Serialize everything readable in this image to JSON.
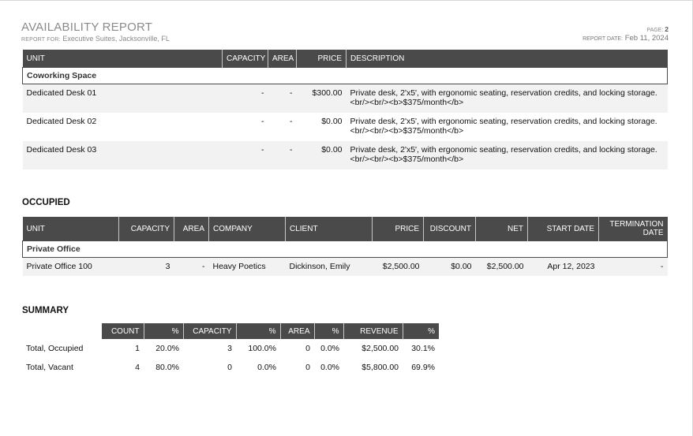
{
  "header": {
    "title": "AVAILABILITY REPORT",
    "report_for_label": "REPORT FOR:",
    "report_for_value": "Executive Suites, Jacksonville, FL",
    "page_label": "PAGE:",
    "page_value": "2",
    "report_date_label": "REPORT DATE:",
    "report_date_value": "Feb 11, 2024"
  },
  "vacant": {
    "columns": [
      "UNIT",
      "CAPACITY",
      "AREA",
      "PRICE",
      "DESCRIPTION"
    ],
    "group": "Coworking Space",
    "rows": [
      {
        "unit": "Dedicated Desk 01",
        "capacity": "-",
        "area": "-",
        "price": "$300.00",
        "description": "Private desk, 2'x5', with ergonomic seating, reservation credits, and locking storage.<br/><br/><b>$375/month</b>"
      },
      {
        "unit": "Dedicated Desk 02",
        "capacity": "-",
        "area": "-",
        "price": "$0.00",
        "description": "Private desk, 2'x5', with ergonomic seating, reservation credits, and locking storage.<br/><br/><b>$375/month</b>"
      },
      {
        "unit": "Dedicated Desk 03",
        "capacity": "-",
        "area": "-",
        "price": "$0.00",
        "description": "Private desk, 2'x5', with ergonomic seating, reservation credits, and locking storage.<br/><br/><b>$375/month</b>"
      }
    ]
  },
  "occupied": {
    "title": "OCCUPIED",
    "columns": [
      "UNIT",
      "CAPACITY",
      "AREA",
      "COMPANY",
      "CLIENT",
      "PRICE",
      "DISCOUNT",
      "NET",
      "START DATE",
      "TERMINATION DATE"
    ],
    "group": "Private Office",
    "rows": [
      {
        "unit": "Private Office 100",
        "capacity": "3",
        "area": "-",
        "company": "Heavy Poetics",
        "client": "Dickinson, Emily",
        "price": "$2,500.00",
        "discount": "$0.00",
        "net": "$2,500.00",
        "start_date": "Apr 12, 2023",
        "termination_date": "-"
      }
    ]
  },
  "summary": {
    "title": "SUMMARY",
    "columns": [
      "",
      "COUNT",
      "%",
      "CAPACITY",
      "%",
      "AREA",
      "%",
      "REVENUE",
      "%"
    ],
    "rows": [
      {
        "label": "Total, Occupied",
        "count": "1",
        "count_pct": "20.0%",
        "capacity": "3",
        "capacity_pct": "100.0%",
        "area": "0",
        "area_pct": "0.0%",
        "revenue": "$2,500.00",
        "revenue_pct": "30.1%"
      },
      {
        "label": "Total, Vacant",
        "count": "4",
        "count_pct": "80.0%",
        "capacity": "0",
        "capacity_pct": "0.0%",
        "area": "0",
        "area_pct": "0.0%",
        "revenue": "$5,800.00",
        "revenue_pct": "69.9%"
      }
    ]
  }
}
